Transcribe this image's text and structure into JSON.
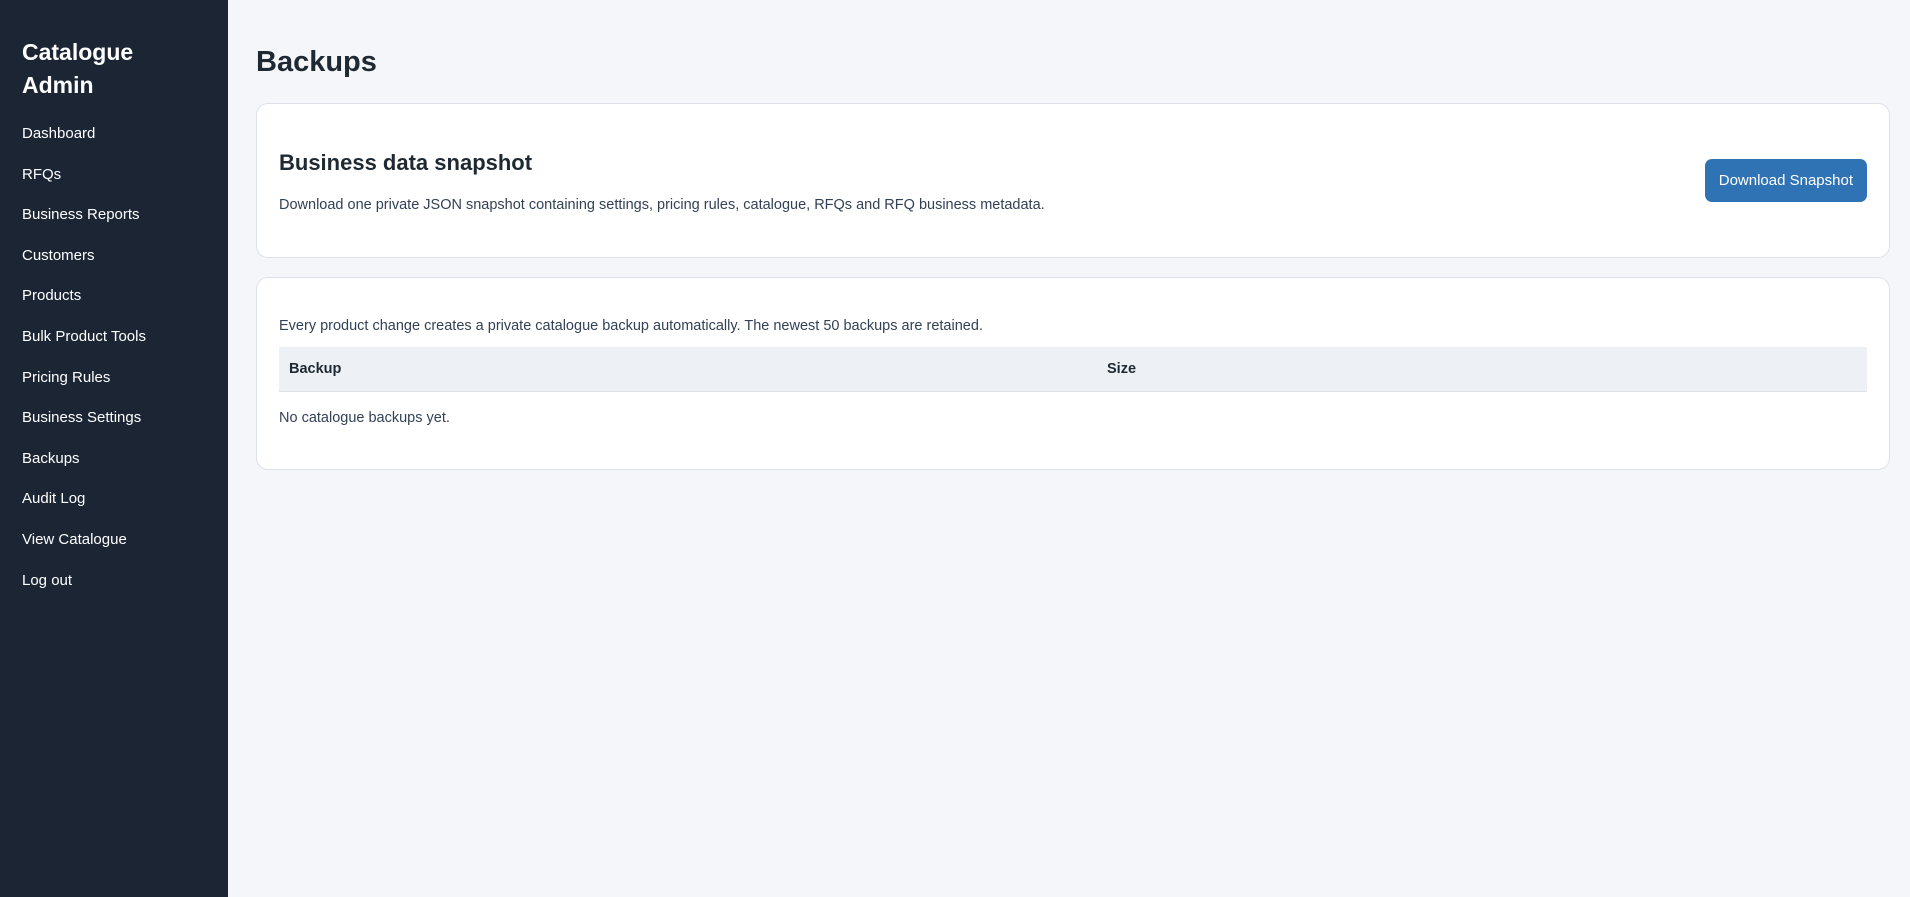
{
  "sidebar": {
    "brand": "Catalogue Admin",
    "items": [
      {
        "label": "Dashboard"
      },
      {
        "label": "RFQs"
      },
      {
        "label": "Business Reports"
      },
      {
        "label": "Customers"
      },
      {
        "label": "Products"
      },
      {
        "label": "Bulk Product Tools"
      },
      {
        "label": "Pricing Rules"
      },
      {
        "label": "Business Settings"
      },
      {
        "label": "Backups"
      },
      {
        "label": "Audit Log"
      },
      {
        "label": "View Catalogue"
      },
      {
        "label": "Log out"
      }
    ]
  },
  "page": {
    "title": "Backups"
  },
  "snapshot": {
    "title": "Business data snapshot",
    "description": "Download one private JSON snapshot containing settings, pricing rules, catalogue, RFQs and RFQ business metadata.",
    "button_label": "Download Snapshot"
  },
  "backups": {
    "note": "Every product change creates a private catalogue backup automatically. The newest 50 backups are retained.",
    "columns": [
      "Backup",
      "Size"
    ],
    "empty_message": "No catalogue backups yet."
  },
  "colors": {
    "sidebar_bg": "#1b2534",
    "accent": "#2f73b5",
    "page_bg": "#f5f6f9"
  }
}
